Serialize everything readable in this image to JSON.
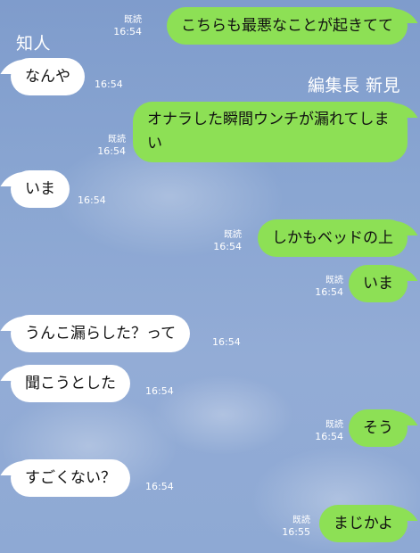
{
  "chat": {
    "senders": {
      "left": "知人",
      "right": "編集長 新見"
    },
    "messages": [
      {
        "side": "out",
        "text": "こちらも最悪なことが起きてて",
        "read": "既読",
        "time": "16:54"
      },
      {
        "side": "in",
        "text": "なんや",
        "time": "16:54"
      },
      {
        "side": "out",
        "text": "オナラした瞬間ウンチが漏れてしまい",
        "read": "既読",
        "time": "16:54"
      },
      {
        "side": "in",
        "text": "いま",
        "time": "16:54"
      },
      {
        "side": "out",
        "text": "しかもベッドの上",
        "read": "既読",
        "time": "16:54"
      },
      {
        "side": "out",
        "text": "いま",
        "read": "既読",
        "time": "16:54"
      },
      {
        "side": "in",
        "text": "うんこ漏らした？って",
        "time": "16:54"
      },
      {
        "side": "in",
        "text": "聞こうとした",
        "time": "16:54"
      },
      {
        "side": "out",
        "text": "そう",
        "read": "既読",
        "time": "16:54"
      },
      {
        "side": "in",
        "text": "すごくない？",
        "time": "16:54"
      },
      {
        "side": "out",
        "text": "まじかよ",
        "read": "既読",
        "time": "16:55"
      }
    ]
  }
}
